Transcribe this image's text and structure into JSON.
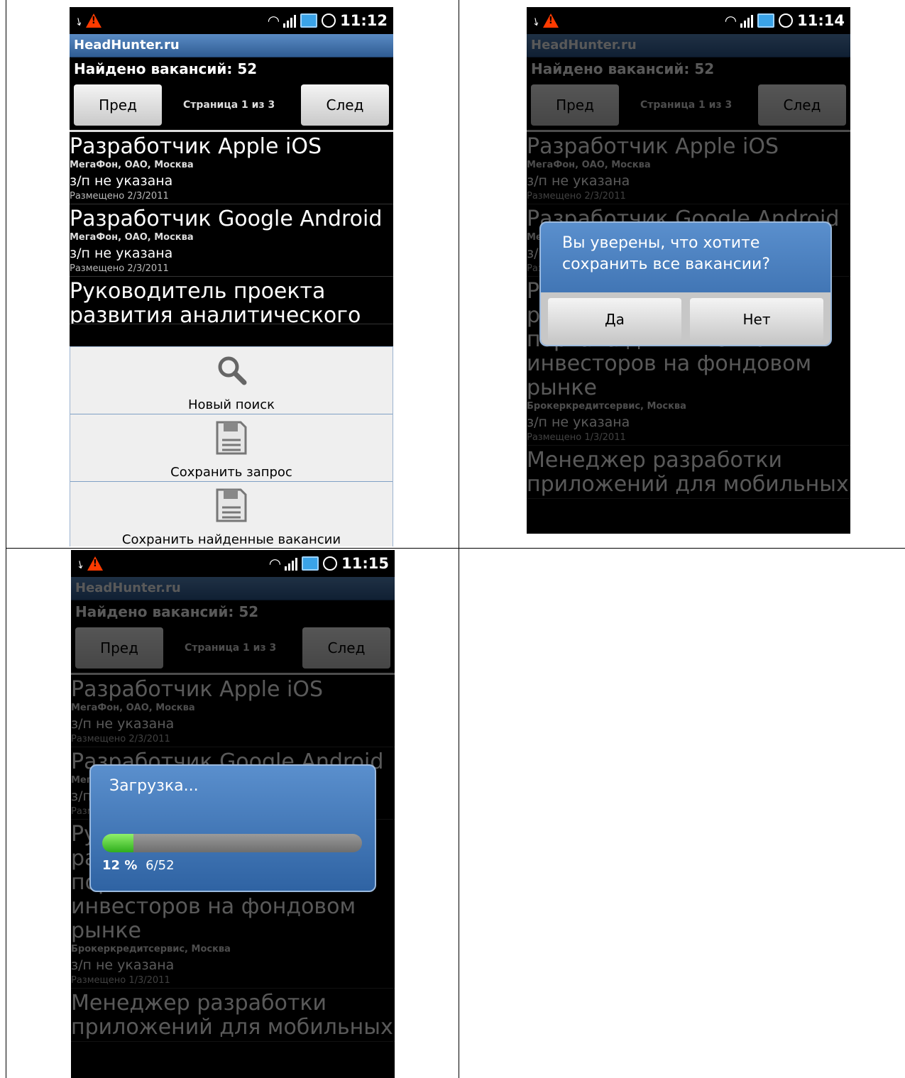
{
  "status_icons": [
    "usb-icon",
    "warning-icon",
    "wifi-icon",
    "signal-icon",
    "battery-icon",
    "alarm-icon"
  ],
  "screens": [
    {
      "time": "11:12"
    },
    {
      "time": "11:14"
    },
    {
      "time": "11:15"
    }
  ],
  "app": {
    "title": "HeadHunter.ru",
    "found": "Найдено вакансий: 52",
    "prev_label": "Пред",
    "next_label": "След",
    "page_info": "Страница 1 из 3"
  },
  "jobs": [
    {
      "title": "Разработчик Apple iOS",
      "company": "МегаФон, ОАО, Москва",
      "salary": "з/п не указана",
      "posted": "Размещено 2/3/2011"
    },
    {
      "title": "Разработчик Google Android",
      "company": "МегаФон, ОАО, Москва",
      "salary": "з/п не указана",
      "posted": "Размещено 2/3/2011"
    },
    {
      "title_lines": [
        "Руководитель проекта",
        "развития аналитического",
        "портала для клиентов-",
        "инвесторов на фондовом",
        "рынке"
      ],
      "company": "Брокеркредитсервис, Москва",
      "salary": "з/п не указана",
      "posted": "Размещено 1/3/2011"
    },
    {
      "title_lines": [
        "Менеджер разработки",
        "приложений для мобильных"
      ]
    }
  ],
  "menu": {
    "new_search": "Новый поиск",
    "save_query": "Сохранить запрос",
    "save_jobs": "Сохранить найденные вакансии"
  },
  "confirm_dialog": {
    "message_lines": [
      "Вы уверены, что хотите",
      "сохранить все вакансии?"
    ],
    "yes": "Да",
    "no": "Нет"
  },
  "progress_dialog": {
    "title": "Загрузка...",
    "percent": "12 %",
    "count": "6/52",
    "progress_fraction": 0.12
  },
  "colors": {
    "accent": "#2f63a3",
    "progress": "#3fbf2a",
    "warning": "#ff3b00"
  }
}
